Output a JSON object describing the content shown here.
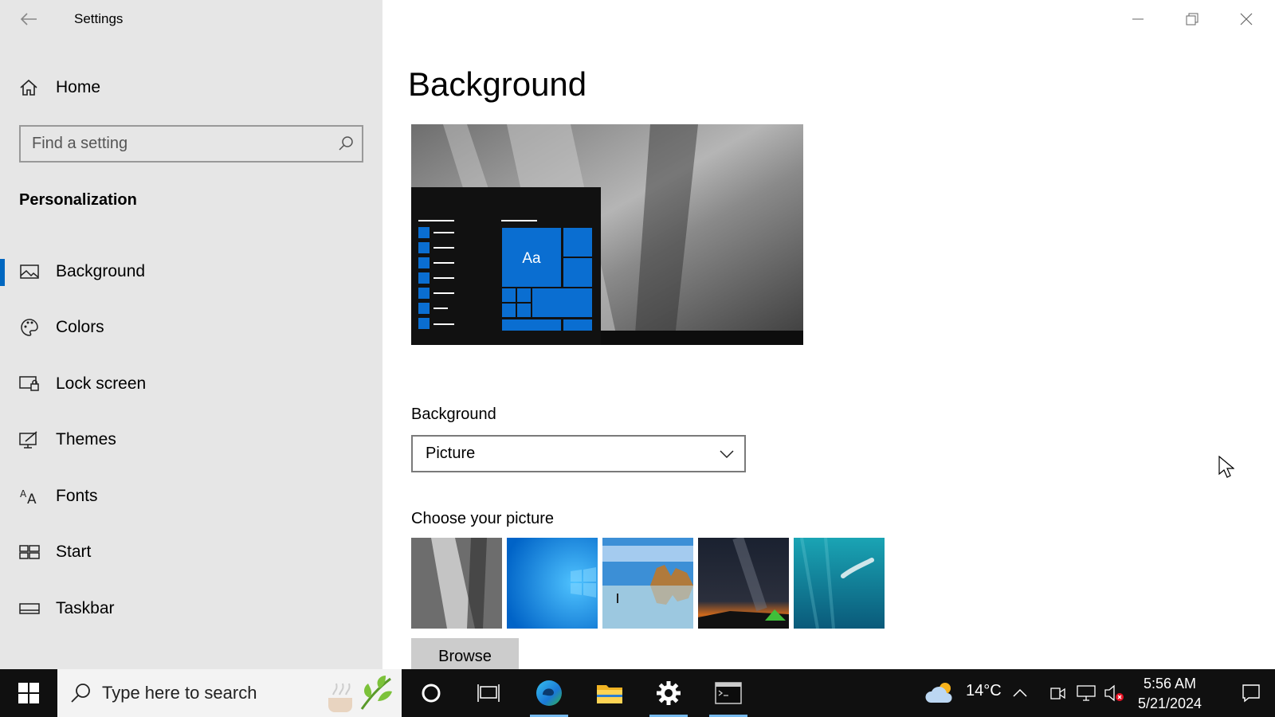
{
  "window": {
    "title": "Settings"
  },
  "sidebar": {
    "home_label": "Home",
    "search_placeholder": "Find a setting",
    "section_title": "Personalization",
    "items": [
      {
        "label": "Background",
        "icon": "picture-icon",
        "active": true
      },
      {
        "label": "Colors",
        "icon": "palette-icon",
        "active": false
      },
      {
        "label": "Lock screen",
        "icon": "lock-screen-icon",
        "active": false
      },
      {
        "label": "Themes",
        "icon": "themes-icon",
        "active": false
      },
      {
        "label": "Fonts",
        "icon": "fonts-icon",
        "active": false
      },
      {
        "label": "Start",
        "icon": "start-icon",
        "active": false
      },
      {
        "label": "Taskbar",
        "icon": "taskbar-icon",
        "active": false
      }
    ]
  },
  "main": {
    "page_title": "Background",
    "preview_tile_text": "Aa",
    "background_label": "Background",
    "background_value": "Picture",
    "choose_label": "Choose your picture",
    "browse_label": "Browse",
    "thumbnails": [
      "rock-face",
      "windows-blue",
      "beach-rocks",
      "milky-way-tent",
      "underwater-swimmer"
    ]
  },
  "taskbar": {
    "search_placeholder": "Type here to search",
    "weather_temp": "14°C",
    "time": "5:56 AM",
    "date": "5/21/2024"
  },
  "colors": {
    "accent": "#0078d7",
    "sidebar_bg": "#e6e6e6",
    "taskbar_bg": "#101010"
  }
}
